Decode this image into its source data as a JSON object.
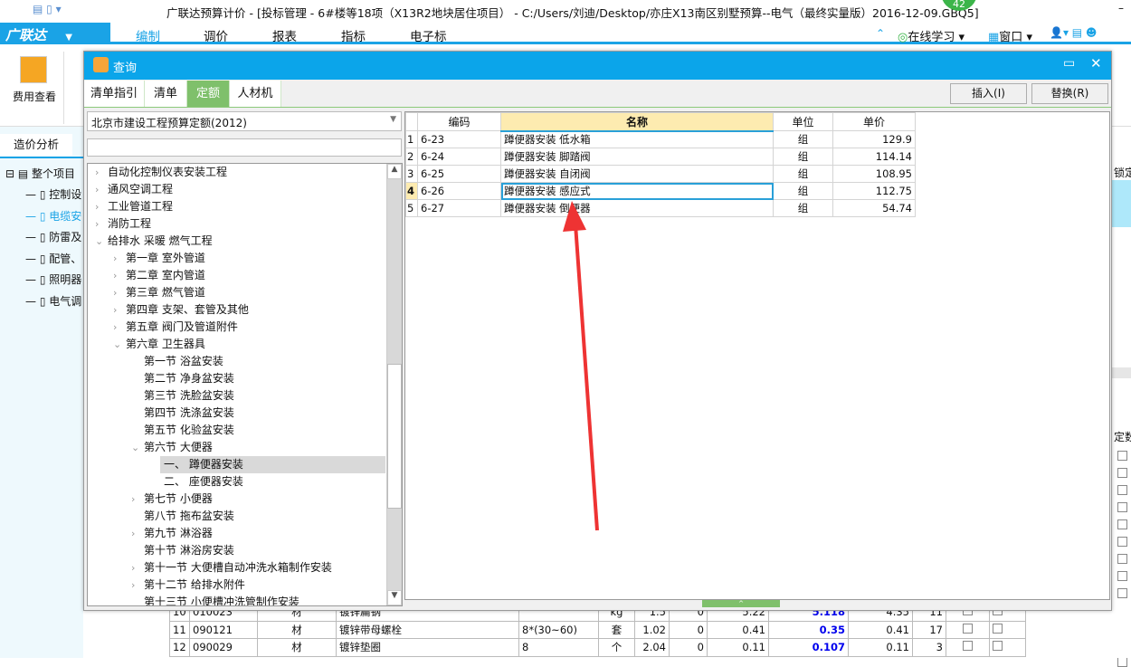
{
  "window": {
    "title": "广联达预算计价 - [投标管理 - 6#楼等18项（X13R2地块居住项目） - C:/Users/刘迪/Desktop/亦庄X13南区别墅预算--电气（最终实量版）2016-12-09.GBQ5]",
    "badge": "42"
  },
  "menubar": {
    "logo": "广联达",
    "tabs": [
      "编制",
      "调价",
      "报表",
      "指标",
      "电子标"
    ],
    "right": [
      "在线学习",
      "窗口"
    ]
  },
  "toolbar": {
    "items": [
      "费用查看"
    ]
  },
  "leftapp": {
    "tab": "造价分析",
    "root": "整个项目",
    "items": [
      "控制设",
      "电缆安",
      "防雷及",
      "配管、",
      "照明器",
      "电气调"
    ]
  },
  "right_strip": {
    "h1": "锁定",
    "h2": "定数"
  },
  "dialog": {
    "title": "查询",
    "tabs": [
      "清单指引",
      "清单",
      "定额",
      "人材机"
    ],
    "active_tab": 2,
    "insert": "插入(I)",
    "replace": "替换(R)",
    "library": "北京市建设工程预算定额(2012)",
    "search": "",
    "tree": [
      {
        "l": 0,
        "a": ">",
        "t": "自动化控制仪表安装工程"
      },
      {
        "l": 0,
        "a": ">",
        "t": "通风空调工程"
      },
      {
        "l": 0,
        "a": ">",
        "t": "工业管道工程"
      },
      {
        "l": 0,
        "a": ">",
        "t": "消防工程"
      },
      {
        "l": 0,
        "a": "v",
        "t": "给排水 采暖 燃气工程"
      },
      {
        "l": 1,
        "a": ">",
        "t": "第一章 室外管道"
      },
      {
        "l": 1,
        "a": ">",
        "t": "第二章 室内管道"
      },
      {
        "l": 1,
        "a": ">",
        "t": "第三章 燃气管道"
      },
      {
        "l": 1,
        "a": ">",
        "t": "第四章 支架、套管及其他"
      },
      {
        "l": 1,
        "a": ">",
        "t": "第五章 阀门及管道附件"
      },
      {
        "l": 1,
        "a": "v",
        "t": "第六章 卫生器具"
      },
      {
        "l": 2,
        "a": "",
        "t": "第一节 浴盆安装"
      },
      {
        "l": 2,
        "a": "",
        "t": "第二节 净身盆安装"
      },
      {
        "l": 2,
        "a": "",
        "t": "第三节 洗脸盆安装"
      },
      {
        "l": 2,
        "a": "",
        "t": "第四节 洗涤盆安装"
      },
      {
        "l": 2,
        "a": "",
        "t": "第五节 化验盆安装"
      },
      {
        "l": 2,
        "a": "v",
        "t": "第六节 大便器"
      },
      {
        "l": 3,
        "a": "",
        "t": "一、 蹲便器安装",
        "sel": true
      },
      {
        "l": 3,
        "a": "",
        "t": "二、 座便器安装"
      },
      {
        "l": 2,
        "a": ">",
        "t": "第七节 小便器"
      },
      {
        "l": 2,
        "a": "",
        "t": "第八节 拖布盆安装"
      },
      {
        "l": 2,
        "a": ">",
        "t": "第九节 淋浴器"
      },
      {
        "l": 2,
        "a": "",
        "t": "第十节 淋浴房安装"
      },
      {
        "l": 2,
        "a": ">",
        "t": "第十一节 大便槽自动冲洗水箱制作安装"
      },
      {
        "l": 2,
        "a": ">",
        "t": "第十二节 给排水附件"
      },
      {
        "l": 2,
        "a": "",
        "t": "第十三节 小便槽冲洗管制作安装"
      }
    ],
    "grid": {
      "headers": [
        "编码",
        "名称",
        "单位",
        "单价"
      ],
      "selected_row": 4,
      "rows": [
        {
          "n": "1",
          "code": "6-23",
          "name": "蹲便器安装 低水箱",
          "unit": "组",
          "price": "129.9"
        },
        {
          "n": "2",
          "code": "6-24",
          "name": "蹲便器安装 脚踏阀",
          "unit": "组",
          "price": "114.14"
        },
        {
          "n": "3",
          "code": "6-25",
          "name": "蹲便器安装 自闭阀",
          "unit": "组",
          "price": "108.95"
        },
        {
          "n": "4",
          "code": "6-26",
          "name": "蹲便器安装 感应式",
          "unit": "组",
          "price": "112.75"
        },
        {
          "n": "5",
          "code": "6-27",
          "name": "蹲便器安装 倒便器",
          "unit": "组",
          "price": "54.74"
        }
      ]
    }
  },
  "bottom_table": [
    [
      "10",
      "010023",
      "材",
      "镀锌扁钢",
      "",
      "kg",
      "1.5",
      "0",
      "5.22",
      "5.118",
      "4.35",
      "11"
    ],
    [
      "11",
      "090121",
      "材",
      "镀锌带母螺栓",
      "8*(30~60)",
      "套",
      "1.02",
      "0",
      "0.41",
      "0.35",
      "0.41",
      "17"
    ],
    [
      "12",
      "090029",
      "材",
      "镀锌垫圈",
      "8",
      "个",
      "2.04",
      "0",
      "0.11",
      "0.107",
      "0.11",
      "3"
    ]
  ],
  "colors": {
    "accent": "#0ba5ea",
    "tab_active": "#7fc06b",
    "header_sel": "#fdebb0",
    "arrow": "#ee3333"
  }
}
